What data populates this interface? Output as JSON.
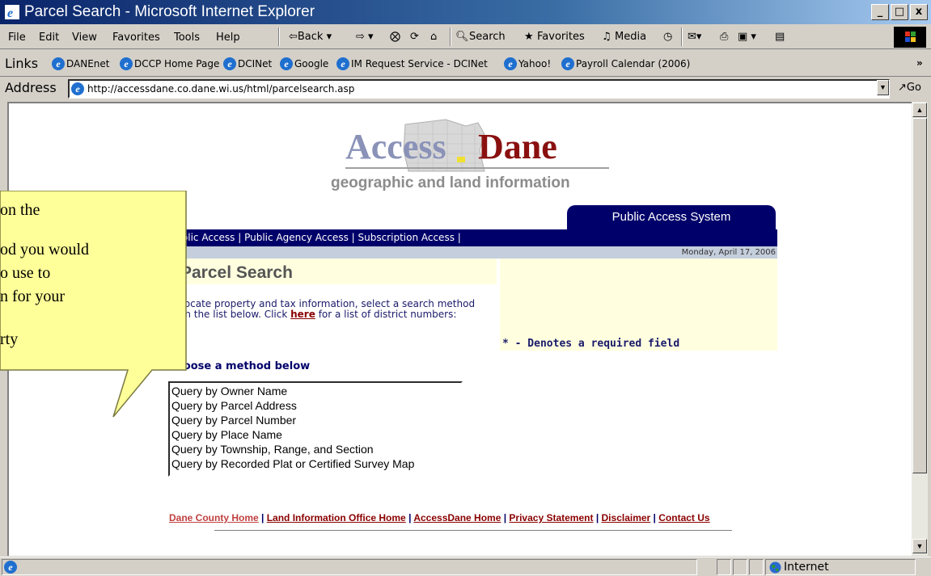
{
  "window": {
    "title": "Parcel Search - Microsoft Internet Explorer",
    "controls": [
      "_",
      "□",
      "x"
    ]
  },
  "menubar": {
    "items": [
      "File",
      "Edit",
      "View",
      "Favorites",
      "Tools",
      "Help"
    ],
    "toolbar": {
      "back": "⇦Back ▾",
      "forward": "⇨ ▾",
      "search": "Search",
      "favorites": "Favorites",
      "media": "Media"
    }
  },
  "links": {
    "label": "Links",
    "items": [
      "DANEnet",
      "DCCP Home Page",
      "DCINet",
      "Google",
      "IM Request Service - DCINet",
      "Yahoo!",
      "Payroll Calendar (2006)"
    ],
    "more": "»"
  },
  "address": {
    "label": "Address",
    "url": "http://accessdane.co.dane.wi.us/html/parcelsearch.asp",
    "go": "Go"
  },
  "page": {
    "logo_access": "Access",
    "logo_dane": "Dane",
    "logo_tagline": "geographic and land information",
    "system_tab": "Public Access System",
    "nav": "Public Access | Public Agency Access | Subscription Access |",
    "date": "Monday, April 17, 2006",
    "title": "Parcel Search",
    "intro_before": "To locate property and tax information, select a search method from the list below. Click ",
    "intro_link": "here",
    "intro_after": " for a list of district numbers:",
    "required_note": "* - Denotes a required field",
    "choose_label": "Choose a method below",
    "methods": [
      "Query by Owner Name",
      "Query by Parcel Address",
      "Query by Parcel Number",
      "Query by Place Name",
      "Query by Township, Range, and Section",
      "Query by Recorded Plat or Certified Survey Map"
    ],
    "footer": [
      "Dane County Home",
      "Land Information Office Home",
      "AccessDane Home",
      "Privacy Statement",
      "Disclaimer",
      "Contact Us"
    ]
  },
  "callout": {
    "lines": [
      "on the",
      "od you would",
      "o use to",
      "n for your",
      "rty"
    ]
  },
  "status": {
    "zone": "Internet"
  },
  "colors": {
    "navy": "#00006a",
    "dark_red": "#8a0000",
    "callout_fill": "#ffff99"
  }
}
